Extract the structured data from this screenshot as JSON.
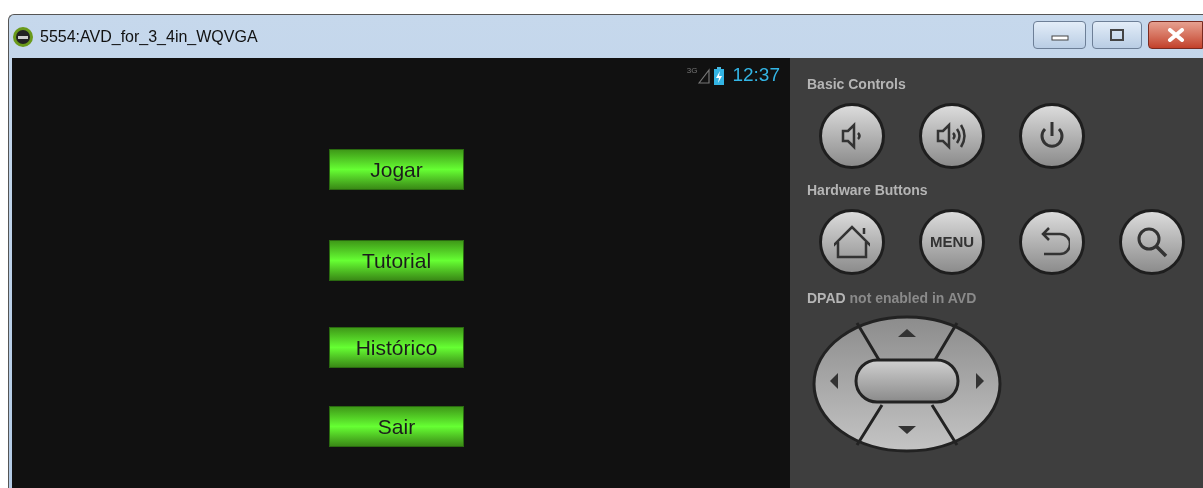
{
  "window": {
    "title": "5554:AVD_for_3_4in_WQVGA"
  },
  "status_bar": {
    "network": "3G",
    "time": "12:37"
  },
  "menu_buttons": [
    "Jogar",
    "Tutorial",
    "Histórico",
    "Sair"
  ],
  "controls": {
    "basic_title": "Basic Controls",
    "basic": [
      {
        "kind": "volume-down"
      },
      {
        "kind": "volume-up"
      },
      {
        "kind": "power"
      }
    ],
    "hardware_title": "Hardware Buttons",
    "hardware": [
      {
        "kind": "home"
      },
      {
        "kind": "menu",
        "label": "MENU"
      },
      {
        "kind": "back"
      },
      {
        "kind": "search"
      }
    ],
    "dpad_note": "**DPAD** not enabled in AVD"
  }
}
